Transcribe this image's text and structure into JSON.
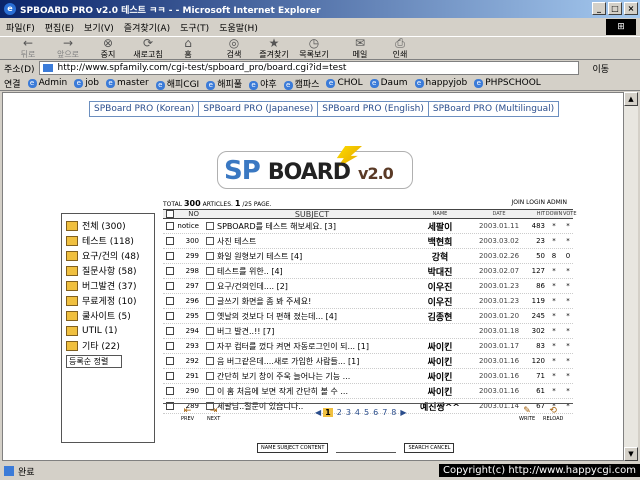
{
  "window": {
    "title": "SPBOARD PRO v2.0 테스트 ㅋㅋ - - Microsoft Internet Explorer"
  },
  "menu": [
    "파일(F)",
    "편집(E)",
    "보기(V)",
    "즐겨찾기(A)",
    "도구(T)",
    "도움말(H)"
  ],
  "toolbar": {
    "back": "뒤로",
    "forward": "앞으로",
    "stop": "중지",
    "refresh": "새로고침",
    "home": "홈",
    "search": "검색",
    "favorites": "즐겨찾기",
    "history": "목록보기",
    "mail": "메일",
    "print": "인쇄"
  },
  "address": {
    "label": "주소(D)",
    "url": "http://www.spfamily.com/cgi-test/spboard_pro/board.cgi?id=test",
    "go": "이동"
  },
  "links": {
    "label": "연결",
    "items": [
      "Admin",
      "job",
      "master",
      "해피CGI",
      "해피풀",
      "야후",
      "캠파스",
      "CHOL",
      "Daum",
      "happyjob",
      "PHPSCHOOL"
    ]
  },
  "tabs": [
    "SPBoard PRO (Korean)",
    "SPBoard PRO (Japanese)",
    "SPBoard PRO (English)",
    "SPBoard PRO (Multilingual)"
  ],
  "logo": {
    "sp": "SP",
    "board": "BOARD",
    "version": "v2.0"
  },
  "summary": {
    "total_label": "TOTAL",
    "articles": "300",
    "articles_label": "ARTICLES.",
    "page": "1",
    "pages": "/25",
    "page_label": "PAGE.",
    "links": "JOIN LOGIN ADMIN"
  },
  "categories": [
    "전체 (300)",
    "테스트 (118)",
    "요구/건의 (48)",
    "질문사항 (58)",
    "버그발견 (37)",
    "무료게정 (10)",
    "쿨사이트 (5)",
    "UTIL (1)",
    "기타 (22)"
  ],
  "sort": "등록순 정렬",
  "header": {
    "no": "NO",
    "subject": "SUBJECT",
    "name": "NAME",
    "date": "DATE",
    "hit": "HIT",
    "down": "DOWN",
    "vote": "VOTE"
  },
  "rows": [
    {
      "no": "notice",
      "subject": "SPBOARD를 테스트 해보세요. [3]",
      "name": "세팔이",
      "date": "2003.01.11",
      "hit": "483",
      "down": "*",
      "vote": "*"
    },
    {
      "no": "300",
      "subject": "사진 테스트",
      "name": "백현희",
      "date": "2003.03.02",
      "hit": "23",
      "down": "*",
      "vote": "*"
    },
    {
      "no": "299",
      "subject": "화일 원형보기 테스트 [4]",
      "name": "강혁",
      "date": "2003.02.26",
      "hit": "50",
      "down": "8",
      "vote": "0"
    },
    {
      "no": "298",
      "subject": "테스트를 위한.. [4]",
      "name": "박대진",
      "date": "2003.02.07",
      "hit": "127",
      "down": "*",
      "vote": "*"
    },
    {
      "no": "297",
      "subject": "요구/건의인데.... [2]",
      "name": "이우진",
      "date": "2003.01.23",
      "hit": "86",
      "down": "*",
      "vote": "*"
    },
    {
      "no": "296",
      "subject": "글쓰기 화면을 좀 봐 주세요!",
      "name": "이우진",
      "date": "2003.01.23",
      "hit": "119",
      "down": "*",
      "vote": "*"
    },
    {
      "no": "295",
      "subject": "옛날의 것보다 더 편해 졌는데... [4]",
      "name": "김종현",
      "date": "2003.01.20",
      "hit": "245",
      "down": "*",
      "vote": "*"
    },
    {
      "no": "294",
      "subject": "버그 발견..!! [7]",
      "name": "",
      "date": "2003.01.18",
      "hit": "302",
      "down": "*",
      "vote": "*"
    },
    {
      "no": "293",
      "subject": "자꾸 컴터를 껐다 켜면 자동로그인이 되... [1]",
      "name": "싸이킨",
      "date": "2003.01.17",
      "hit": "83",
      "down": "*",
      "vote": "*"
    },
    {
      "no": "292",
      "subject": "음 버그같은데....새로 가입한 사람들... [1]",
      "name": "싸이킨",
      "date": "2003.01.16",
      "hit": "120",
      "down": "*",
      "vote": "*"
    },
    {
      "no": "291",
      "subject": "간단히 보기 창이 주욱 늘어나는 기능 ...",
      "name": "싸이킨",
      "date": "2003.01.16",
      "hit": "71",
      "down": "*",
      "vote": "*"
    },
    {
      "no": "290",
      "subject": "이 홈 처음에 보면 작게 간단히 볼 수 ...",
      "name": "싸이킨",
      "date": "2003.01.16",
      "hit": "61",
      "down": "*",
      "vote": "*"
    },
    {
      "no": "289",
      "subject": "세팔님..질문이 있습니다..",
      "name": "예진짱^^",
      "date": "2003.01.14",
      "hit": "67",
      "down": "*",
      "vote": "*"
    }
  ],
  "footer": {
    "prev": "PREV",
    "next": "NEXT",
    "write": "WRITE",
    "reload": "RELOAD",
    "current_page": "1",
    "pages": [
      "2",
      "3",
      "4",
      "5",
      "6",
      "7",
      "8"
    ]
  },
  "search": {
    "name": "NAME",
    "subject": "SUBJECT",
    "content": "CONTENT",
    "search_btn": "SEARCH",
    "cancel_btn": "CANCEL"
  },
  "status": {
    "text": "완료"
  },
  "copyright": "Copyright(c) http://www.happycgi.com"
}
